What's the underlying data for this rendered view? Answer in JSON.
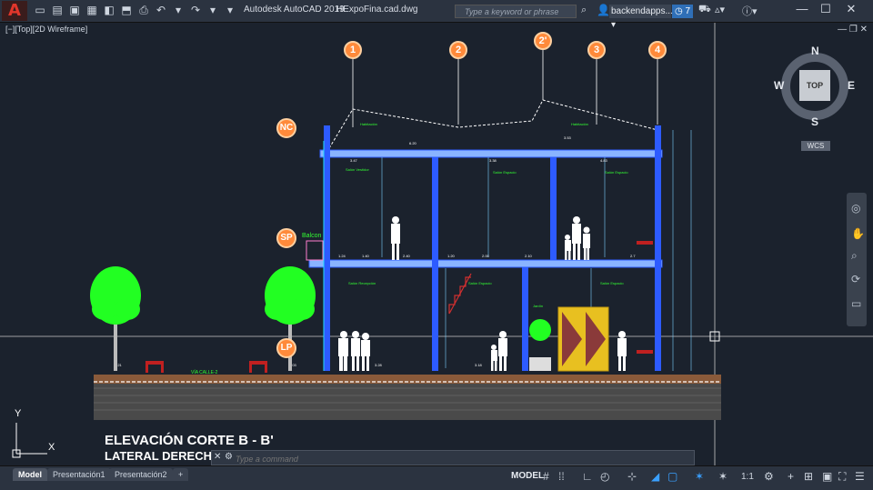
{
  "app": {
    "logo_letter": "A",
    "title": "Autodesk AutoCAD 2019",
    "filename": "HExpoFina.cad.dwg",
    "search_placeholder": "Type a keyword or phrase",
    "user": "backendapps...",
    "notifications": "7",
    "help": "?"
  },
  "viewport": {
    "label": "[−][Top][2D Wireframe]",
    "controls": "— ❐ ✕"
  },
  "viewcube": {
    "n": "N",
    "s": "S",
    "e": "E",
    "w": "W",
    "face": "TOP",
    "wcs": "WCS"
  },
  "drawing": {
    "axis_labels": [
      "1",
      "2",
      "2'",
      "3",
      "4"
    ],
    "level_labels": [
      "NC",
      "SP",
      "LP"
    ],
    "balcon_label": "Balcon",
    "title1": "ELEVACIÓN CORTE B - B'",
    "title2": "LATERAL DERECHA",
    "street_label": "VÍA CALLE-2",
    "ucs_y": "Y",
    "ucs_x": "X"
  },
  "command": {
    "placeholder": "Type a command"
  },
  "tabs": [
    "Model",
    "Presentación1",
    "Presentación2",
    "+"
  ],
  "status": {
    "model": "MODEL",
    "scale": "1:1"
  },
  "colors": {
    "bg": "#1b222d",
    "structure": "#2d5bff",
    "plant": "#22ff22",
    "text_green": "#33ff33",
    "ground": "#8a5a3a",
    "marker": "#ff8a3a",
    "door": "#e8c020"
  }
}
